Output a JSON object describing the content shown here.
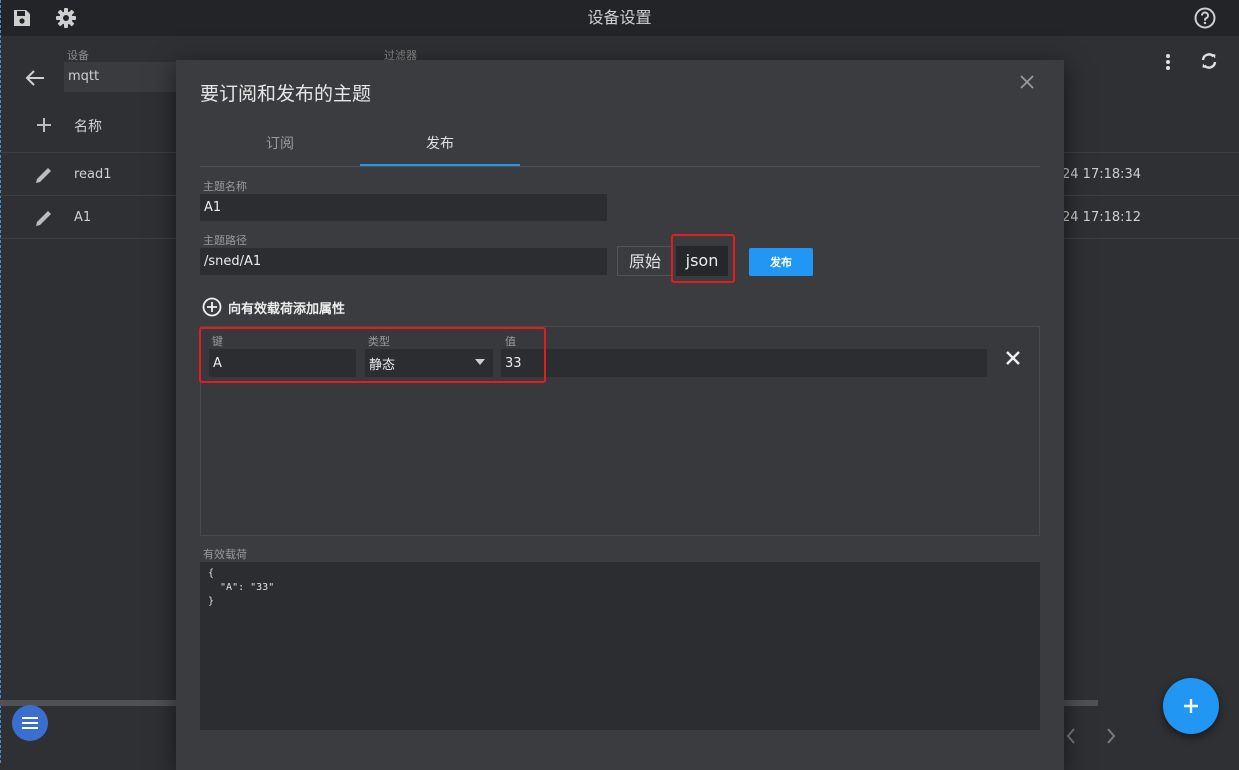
{
  "topbar": {
    "title": "设备设置",
    "save_icon": "save-icon",
    "settings_icon": "gear-icon",
    "help_icon": "help-icon"
  },
  "background": {
    "device_label": "设备",
    "device_value": "mqtt",
    "filter_label": "过滤器",
    "name_header": "名称",
    "rows": [
      {
        "name": "read1",
        "time": "24 17:18:34"
      },
      {
        "name": "A1",
        "time": "24 17:18:12"
      }
    ]
  },
  "dialog": {
    "title": "要订阅和发布的主题",
    "tabs": [
      "订阅",
      "发布"
    ],
    "active_tab": "发布",
    "topic_name_label": "主题名称",
    "topic_name_value": "A1",
    "topic_path_label": "主题路径",
    "topic_path_value": "/sned/A1",
    "format_raw": "原始",
    "format_json": "json",
    "publish_button": "发布",
    "add_property_label": "向有效载荷添加属性",
    "property": {
      "key_label": "键",
      "key_value": "A",
      "type_label": "类型",
      "type_value": "静态",
      "value_label": "值",
      "value_value": "33"
    },
    "payload_label": "有效载荷",
    "payload_lines": [
      "{",
      "  \"A\": \"33\"",
      "}"
    ]
  },
  "colors": {
    "accent": "#2196f3",
    "highlight": "#e11d1d",
    "dialog_bg": "#3b3c3f",
    "page_bg": "#2f3033"
  }
}
